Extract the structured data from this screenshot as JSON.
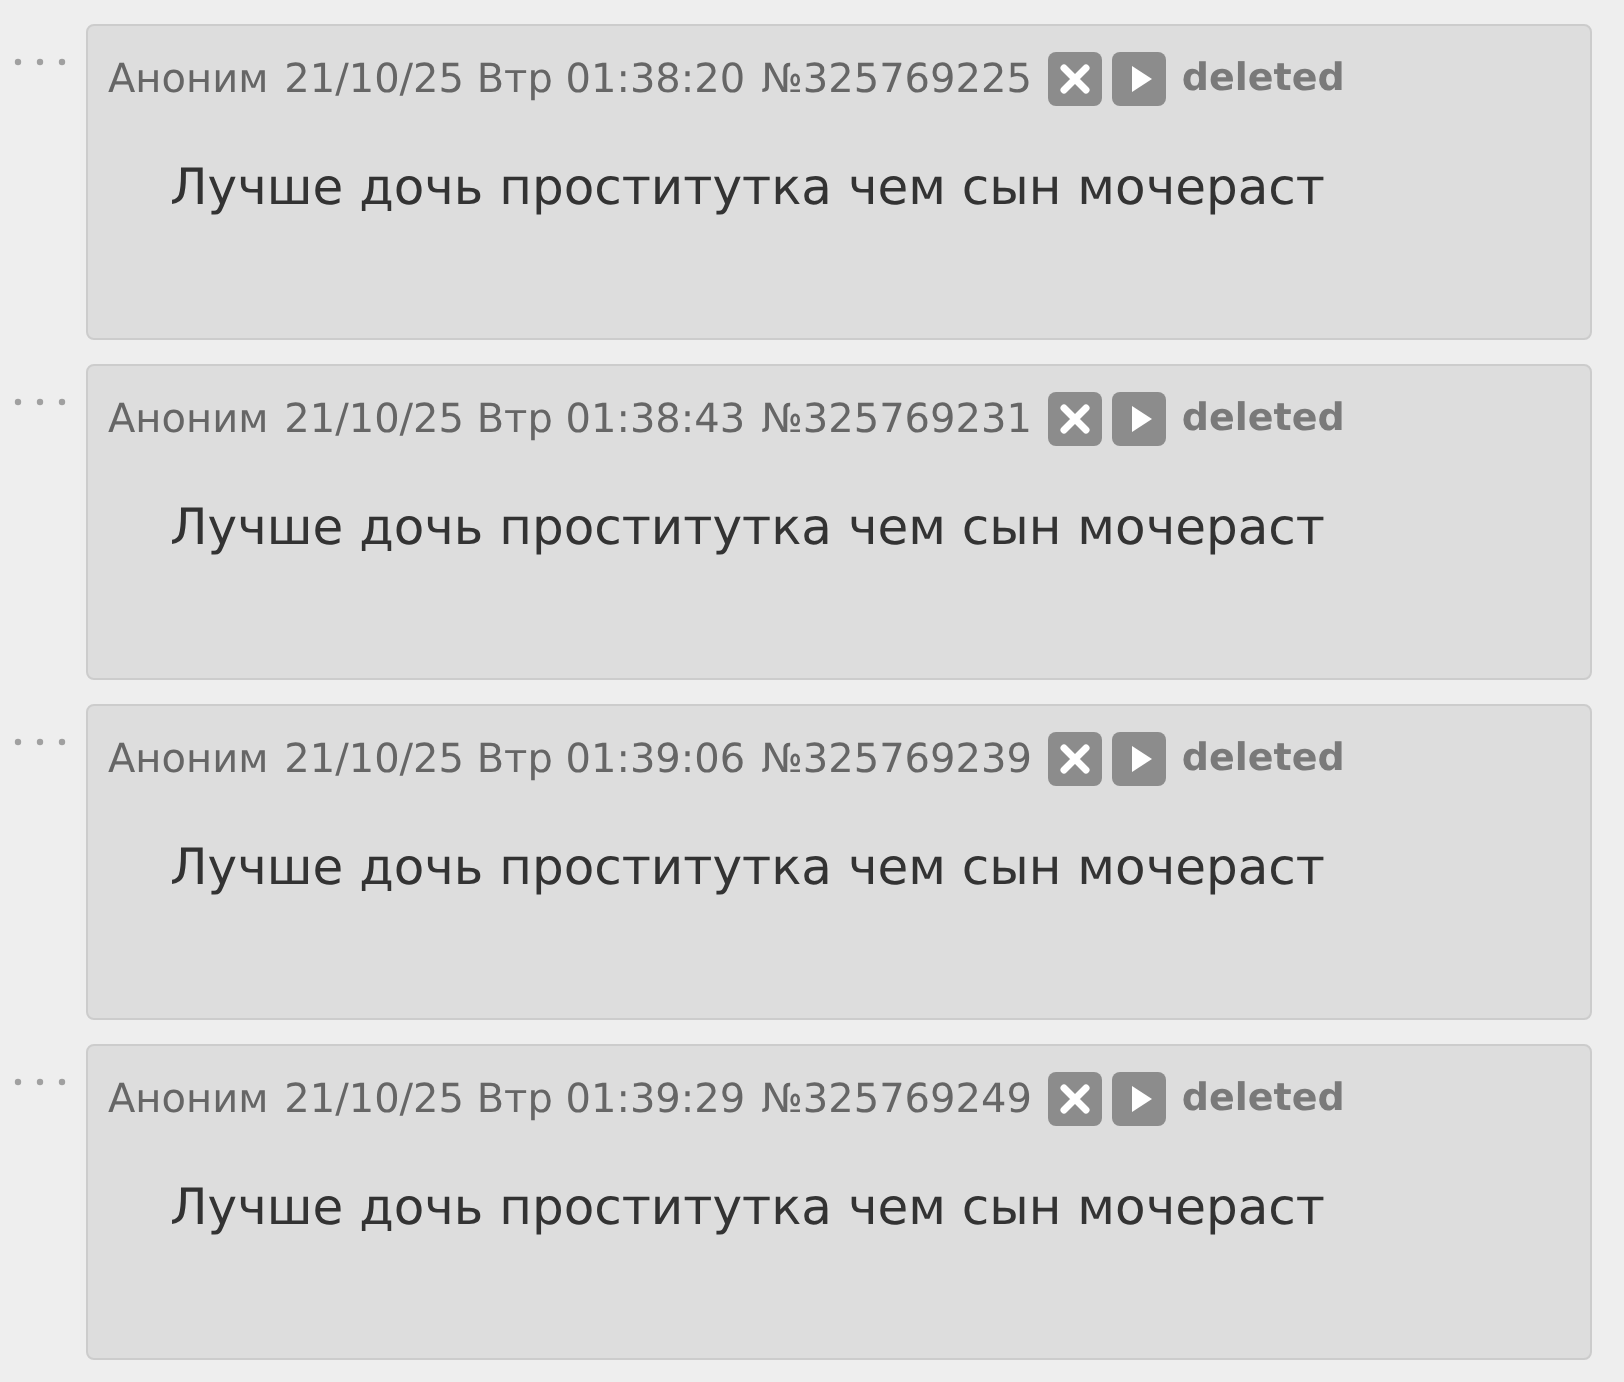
{
  "posts": [
    {
      "name": "Аноним",
      "date": "21/10/25 Втр 01:38:20",
      "number": "№325769225",
      "status": "deleted",
      "text": "Лучше дочь проститутка чем сын мочераст"
    },
    {
      "name": "Аноним",
      "date": "21/10/25 Втр 01:38:43",
      "number": "№325769231",
      "status": "deleted",
      "text": "Лучше дочь проститутка чем сын мочераст"
    },
    {
      "name": "Аноним",
      "date": "21/10/25 Втр 01:39:06",
      "number": "№325769239",
      "status": "deleted",
      "text": "Лучше дочь проститутка чем сын мочераст"
    },
    {
      "name": "Аноним",
      "date": "21/10/25 Втр 01:39:29",
      "number": "№325769249",
      "status": "deleted",
      "text": "Лучше дочь проститутка чем сын мочераст"
    }
  ]
}
